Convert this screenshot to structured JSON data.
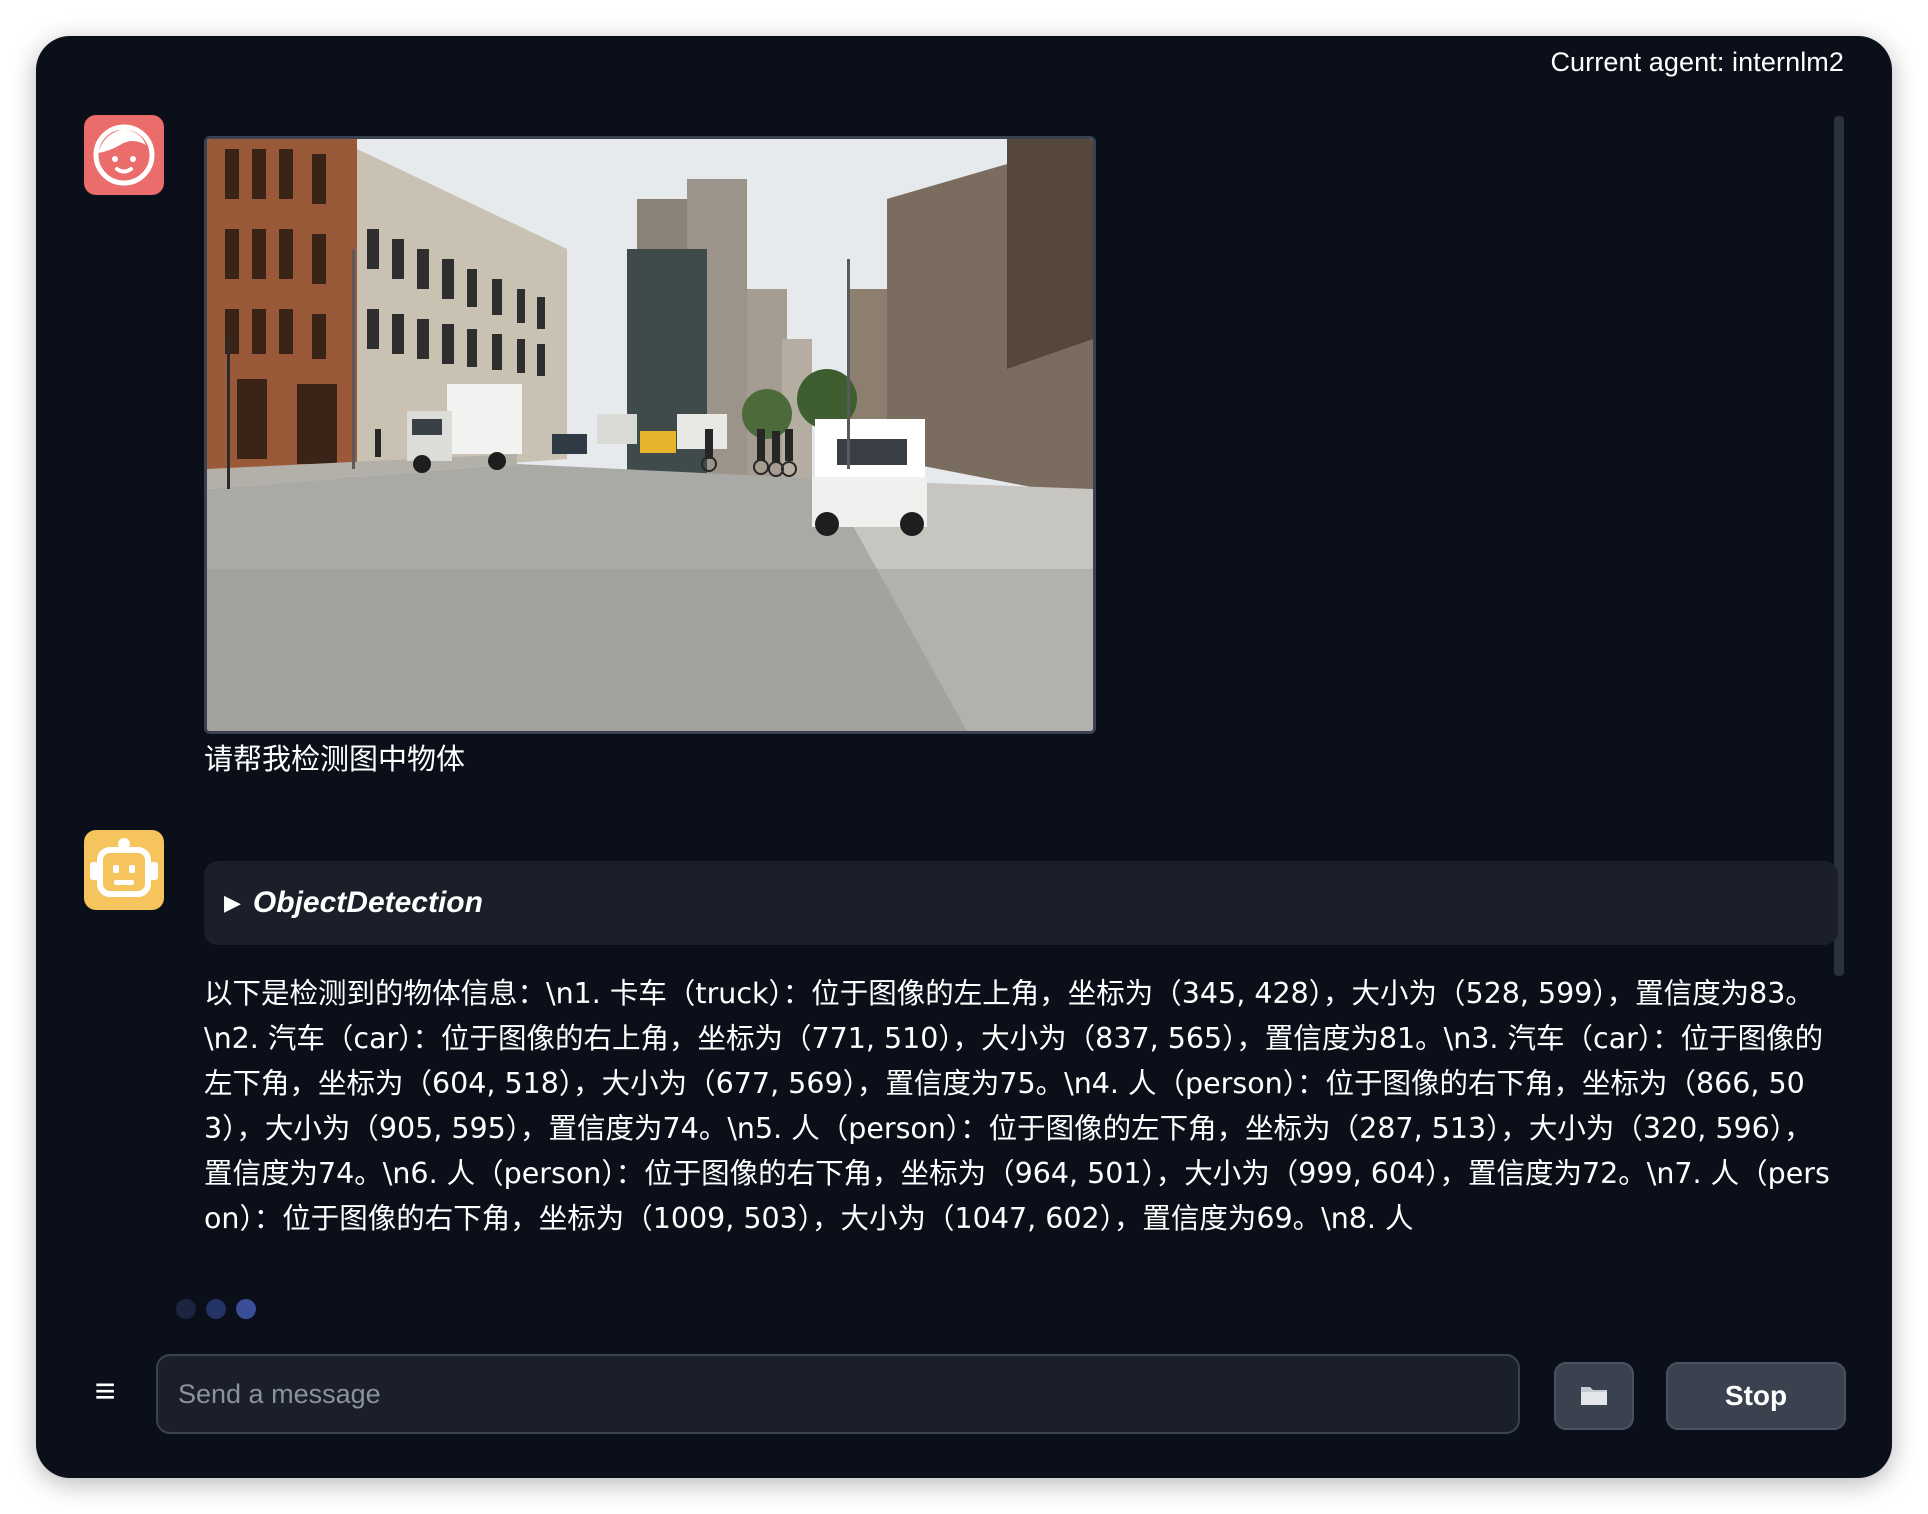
{
  "header": {
    "agent_label": "Current agent: internlm2"
  },
  "chat": {
    "user_message": {
      "avatar_icon": "user-face-icon",
      "image_description_icon": "street-photo",
      "text": "请帮我检测图中物体"
    },
    "bot_message": {
      "avatar_icon": "robot-icon",
      "tool": {
        "arrow": "▶",
        "name": "ObjectDetection"
      },
      "text": "以下是检测到的物体信息：\\n1. 卡车（truck）：位于图像的左上角，坐标为（345, 428），大小为（528, 599），置信度为83。\\n2. 汽车（car）：位于图像的右上角，坐标为（771, 510），大小为（837, 565），置信度为81。\\n3. 汽车（car）：位于图像的左下角，坐标为（604, 518），大小为（677, 569），置信度为75。\\n4. 人（person）：位于图像的右下角，坐标为（866, 503），大小为（905, 595），置信度为74。\\n5. 人（person）：位于图像的左下角，坐标为（287, 513），大小为（320, 596），置信度为74。\\n6. 人（person）：位于图像的右下角，坐标为（964, 501），大小为（999, 604），置信度为72。\\n7. 人（person）：位于图像的右下角，坐标为（1009, 503），大小为（1047, 602），置信度为69。\\n8. 人"
    }
  },
  "composer": {
    "menu_icon": "≡",
    "placeholder": "Send a message",
    "upload_icon": "folder-icon",
    "stop_label": "Stop"
  },
  "colors": {
    "background": "#0b0f19",
    "panel": "#1b1f2a",
    "user_avatar": "#ea6d6b",
    "bot_avatar": "#f5c45c",
    "button": "#3a414f"
  }
}
